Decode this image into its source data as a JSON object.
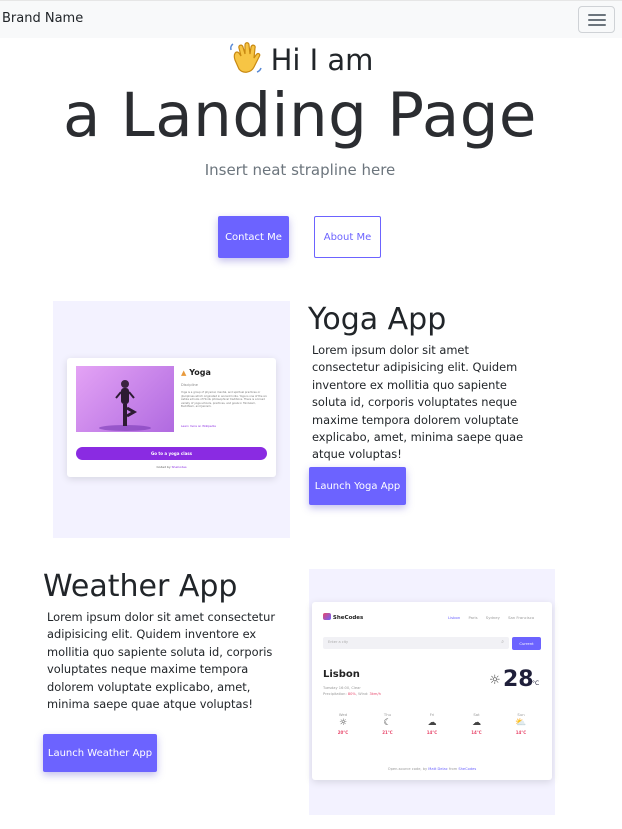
{
  "navbar": {
    "brand": "Brand Name",
    "toggle_icon": "hamburger-icon"
  },
  "hero": {
    "greeting": "Hi I am",
    "greeting_icon": "waving-hand-icon",
    "title": "a Landing Page",
    "strapline": "Insert neat strapline here",
    "contact_label": "Contact Me",
    "about_label": "About Me"
  },
  "yoga": {
    "title": "Yoga App",
    "text": "Lorem ipsum dolor sit amet consectetur adipisicing elit. Quidem inventore ex mollitia quo sapiente soluta id, corporis voluptates neque maxime tempora dolorem voluptate explicabo, amet, minima saepe quae atque voluptas!",
    "button": "Launch Yoga App",
    "preview": {
      "title": "Yoga",
      "subtitle": "Discipline",
      "body": "Yoga is a group of physical, mental, and spiritual practices or disciplines which originated in ancient India. Yoga is one of the six Āstika schools of Hindu philosophical traditions. There is a broad variety of yoga schools, practices, and goals in Hinduism, Buddhism, and Jainism.",
      "link": "Learn more on Wikipedia",
      "cta": "Go to a yoga class",
      "footer_prefix": "Coded by",
      "footer_author": "SheCodes"
    }
  },
  "weather": {
    "title": "Weather App",
    "text": "Lorem ipsum dolor sit amet consectetur adipisicing elit. Quidem inventore ex mollitia quo sapiente soluta id, corporis voluptates neque maxime tempora dolorem voluptate explicabo, amet, minima saepe quae atque voluptas!",
    "button": "Launch Weather App",
    "preview": {
      "logo": "SheCodes",
      "nav": [
        "Lisbon",
        "Paris",
        "Sydney",
        "San Francisco"
      ],
      "search_placeholder": "Enter a city",
      "current_label": "Current",
      "city": "Lisbon",
      "date": "Tuesday 16:00, Clear",
      "details_prefix": "Precipitation:",
      "precipitation": "80%",
      "details_wind": "Wind:",
      "wind": "3km/h",
      "temp": "28",
      "unit": "°C",
      "forecast": [
        {
          "day": "Wed",
          "temp": "20°C",
          "icon": "sun-icon"
        },
        {
          "day": "Thu",
          "temp": "21°C",
          "icon": "moon-icon"
        },
        {
          "day": "Fri",
          "temp": "14°C",
          "icon": "cloud-icon"
        },
        {
          "day": "Sat",
          "temp": "14°C",
          "icon": "cloud-icon"
        },
        {
          "day": "Sun",
          "temp": "14°C",
          "icon": "partly-cloudy-icon"
        }
      ],
      "footer_a": "Open-source code, by",
      "footer_author": "Matt Delac",
      "footer_b": "from",
      "footer_org": "SheCodes"
    }
  },
  "colors": {
    "accent": "#6c63ff",
    "hero_text": "#2b2d31",
    "muted": "#6c757d",
    "navbar_bg": "#f8f9fa",
    "preview_bg": "#f3f2ff",
    "yoga_purple": "#8a2be2",
    "temp_red": "#e8476b"
  }
}
